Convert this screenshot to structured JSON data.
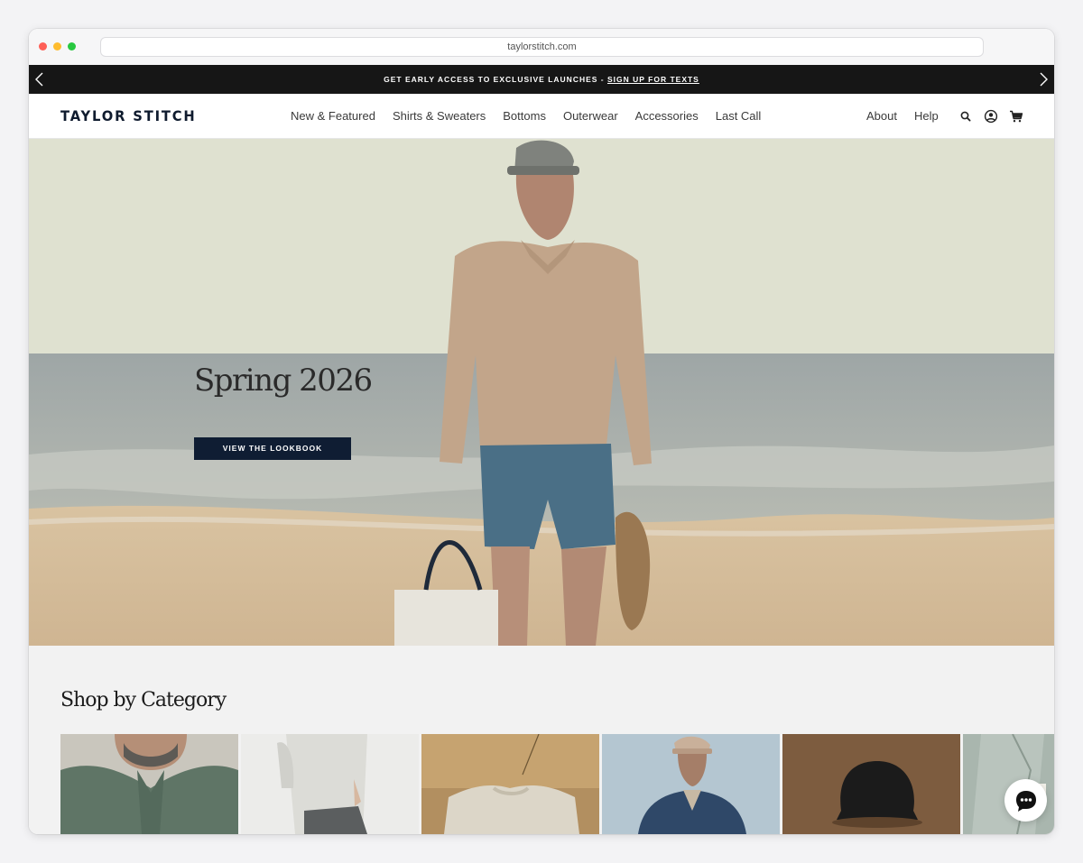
{
  "browser": {
    "url": "taylorstitch.com"
  },
  "promo": {
    "text": "GET EARLY ACCESS TO EXCLUSIVE LAUNCHES - ",
    "link": "SIGN UP FOR TEXTS"
  },
  "header": {
    "logo": "TAYLOR STITCH",
    "menu": [
      "New & Featured",
      "Shirts & Sweaters",
      "Bottoms",
      "Outerwear",
      "Accessories",
      "Last Call"
    ],
    "utility": [
      "About",
      "Help"
    ],
    "icons": [
      "search-icon",
      "account-icon",
      "cart-icon"
    ]
  },
  "hero": {
    "title": "Spring 2026",
    "cta": "VIEW THE LOOKBOOK"
  },
  "category": {
    "title": "Shop by Category"
  },
  "colors": {
    "navy": "#0f1d33",
    "promo_bg": "#161616"
  }
}
